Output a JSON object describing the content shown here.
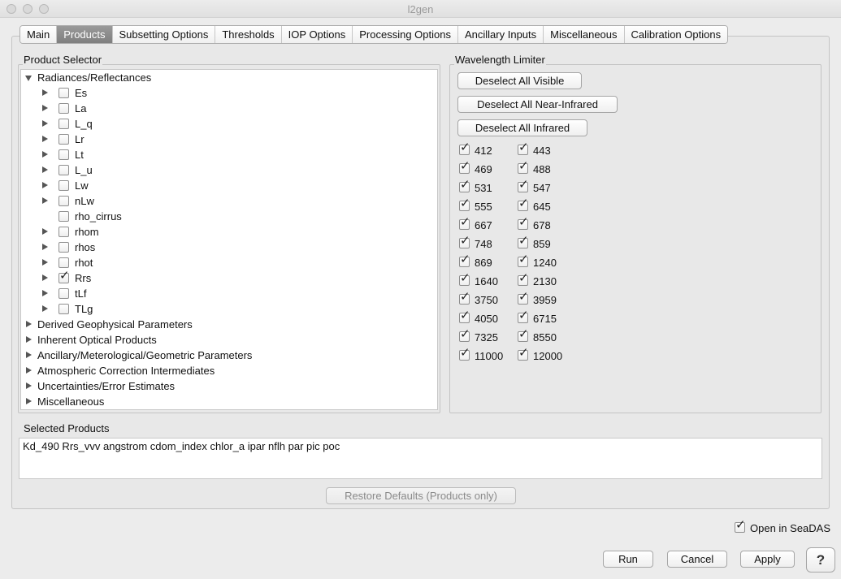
{
  "window": {
    "title": "l2gen"
  },
  "tabs": [
    {
      "label": "Main"
    },
    {
      "label": "Products",
      "active": true
    },
    {
      "label": "Subsetting Options"
    },
    {
      "label": "Thresholds"
    },
    {
      "label": "IOP Options"
    },
    {
      "label": "Processing Options"
    },
    {
      "label": "Ancillary Inputs"
    },
    {
      "label": "Miscellaneous"
    },
    {
      "label": "Calibration Options"
    }
  ],
  "product_selector": {
    "title": "Product Selector",
    "root": {
      "label": "Radiances/Reflectances",
      "expanded": true
    },
    "children": [
      {
        "label": "Es",
        "expandable": true,
        "checked": false
      },
      {
        "label": "La",
        "expandable": true,
        "checked": false
      },
      {
        "label": "L_q",
        "expandable": true,
        "checked": false
      },
      {
        "label": "Lr",
        "expandable": true,
        "checked": false
      },
      {
        "label": "Lt",
        "expandable": true,
        "checked": false
      },
      {
        "label": "L_u",
        "expandable": true,
        "checked": false
      },
      {
        "label": "Lw",
        "expandable": true,
        "checked": false
      },
      {
        "label": "nLw",
        "expandable": true,
        "checked": false
      },
      {
        "label": "rho_cirrus",
        "expandable": false,
        "checked": false
      },
      {
        "label": "rhom",
        "expandable": true,
        "checked": false
      },
      {
        "label": "rhos",
        "expandable": true,
        "checked": false
      },
      {
        "label": "rhot",
        "expandable": true,
        "checked": false
      },
      {
        "label": "Rrs",
        "expandable": true,
        "checked": true
      },
      {
        "label": "tLf",
        "expandable": true,
        "checked": false
      },
      {
        "label": "TLg",
        "expandable": true,
        "checked": false
      }
    ],
    "categories": [
      {
        "label": "Derived Geophysical Parameters"
      },
      {
        "label": "Inherent Optical Products"
      },
      {
        "label": "Ancillary/Meterological/Geometric Parameters"
      },
      {
        "label": "Atmospheric Correction Intermediates"
      },
      {
        "label": "Uncertainties/Error Estimates"
      },
      {
        "label": "Miscellaneous"
      }
    ]
  },
  "wavelength_limiter": {
    "title": "Wavelength Limiter",
    "buttons": [
      {
        "label": "Deselect All Visible"
      },
      {
        "label": "Deselect All Near-Infrared"
      },
      {
        "label": "Deselect All Infrared"
      }
    ],
    "wavelengths": [
      [
        "412",
        "443"
      ],
      [
        "469",
        "488"
      ],
      [
        "531",
        "547"
      ],
      [
        "555",
        "645"
      ],
      [
        "667",
        "678"
      ],
      [
        "748",
        "859"
      ],
      [
        "869",
        "1240"
      ],
      [
        "1640",
        "2130"
      ],
      [
        "3750",
        "3959"
      ],
      [
        "4050",
        "6715"
      ],
      [
        "7325",
        "8550"
      ],
      [
        "11000",
        "12000"
      ]
    ],
    "checked": true
  },
  "selected_products": {
    "title": "Selected Products",
    "value": "Kd_490 Rrs_vvv angstrom cdom_index chlor_a ipar nflh par pic poc"
  },
  "restore_defaults": {
    "label": "Restore Defaults (Products only)",
    "enabled": false
  },
  "open_in_seadas": {
    "label": "Open in SeaDAS",
    "checked": true
  },
  "actions": {
    "run": "Run",
    "cancel": "Cancel",
    "apply": "Apply",
    "help": "?"
  }
}
